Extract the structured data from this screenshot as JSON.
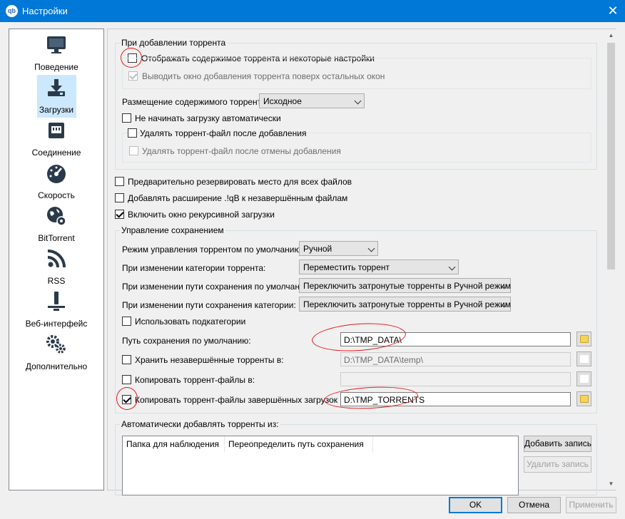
{
  "window": {
    "title": "Настройки",
    "icon_text": "qb",
    "close_glyph": "✕"
  },
  "sidebar": {
    "items": [
      {
        "label": "Поведение",
        "icon": "monitor-icon",
        "selected": false
      },
      {
        "label": "Загрузки",
        "icon": "download-icon",
        "selected": true
      },
      {
        "label": "Соединение",
        "icon": "network-icon",
        "selected": false
      },
      {
        "label": "Скорость",
        "icon": "speedometer-icon",
        "selected": false
      },
      {
        "label": "BitTorrent",
        "icon": "globe-gear-icon",
        "selected": false
      },
      {
        "label": "RSS",
        "icon": "rss-icon",
        "selected": false
      },
      {
        "label": "Веб-интерфейс",
        "icon": "web-ui-icon",
        "selected": false
      },
      {
        "label": "Дополнительно",
        "icon": "gears-icon",
        "selected": false
      }
    ]
  },
  "on_add": {
    "group_title": "При добавлении торрента",
    "show_content": {
      "label": "Отображать содержимое торрента и некоторые настройки",
      "checked": false
    },
    "on_top": {
      "label": "Выводить окно добавления торрента поверх остальных окон",
      "checked": true,
      "disabled": true
    },
    "layout_label": "Размещение содержимого торрента:",
    "layout_value": "Исходное",
    "no_autostart": {
      "label": "Не начинать загрузку автоматически",
      "checked": false
    },
    "delete_after_add": {
      "label": "Удалять торрент-файл после добавления",
      "checked": false
    },
    "delete_after_cancel": {
      "label": "Удалять торрент-файл после отмены добавления",
      "checked": false,
      "disabled": true
    }
  },
  "general": {
    "preallocate": {
      "label": "Предварительно резервировать место для всех файлов",
      "checked": false
    },
    "append_ext": {
      "label": "Добавлять расширение .!qB к незавершённым файлам",
      "checked": false
    },
    "recursive": {
      "label": "Включить окно рекурсивной загрузки",
      "checked": true
    }
  },
  "saving": {
    "group_title": "Управление сохранением",
    "rows": [
      {
        "label": "Режим управления торрентом по умолчанию:",
        "value": "Ручной"
      },
      {
        "label": "При изменении категории торрента:",
        "value": "Переместить торрент"
      },
      {
        "label": "При изменении пути сохранения по умолчанию:",
        "value": "Переключить затронутые торренты в Ручной режим"
      },
      {
        "label": "При изменении пути сохранения категории:",
        "value": "Переключить затронутые торренты в Ручной режим"
      }
    ],
    "use_subcategories": {
      "label": "Использовать подкатегории",
      "checked": false
    },
    "default_path_label": "Путь сохранения по умолчанию:",
    "default_path_value": "D:\\TMP_DATA\\",
    "incomplete": {
      "label": "Хранить незавершённые торренты в:",
      "checked": false,
      "value": "D:\\TMP_DATA\\temp\\"
    },
    "copy_torrents": {
      "label": "Копировать торрент-файлы в:",
      "checked": false,
      "value": ""
    },
    "copy_finished": {
      "label": "Копировать торрент-файлы завершённых загрузок в:",
      "checked": true,
      "value": "D:\\TMP_TORRENTS"
    }
  },
  "watch": {
    "group_title": "Автоматически добавлять торренты из:",
    "columns": [
      "Папка для наблюдения",
      "Переопределить путь сохранения"
    ],
    "add_button": "Добавить запись",
    "remove_button": "Удалить запись"
  },
  "footer": {
    "ok": "OK",
    "cancel": "Отмена",
    "apply": "Применить"
  },
  "colors": {
    "titlebar": "#0078d7",
    "selection": "#cce8ff",
    "annotation": "#e8151b"
  }
}
